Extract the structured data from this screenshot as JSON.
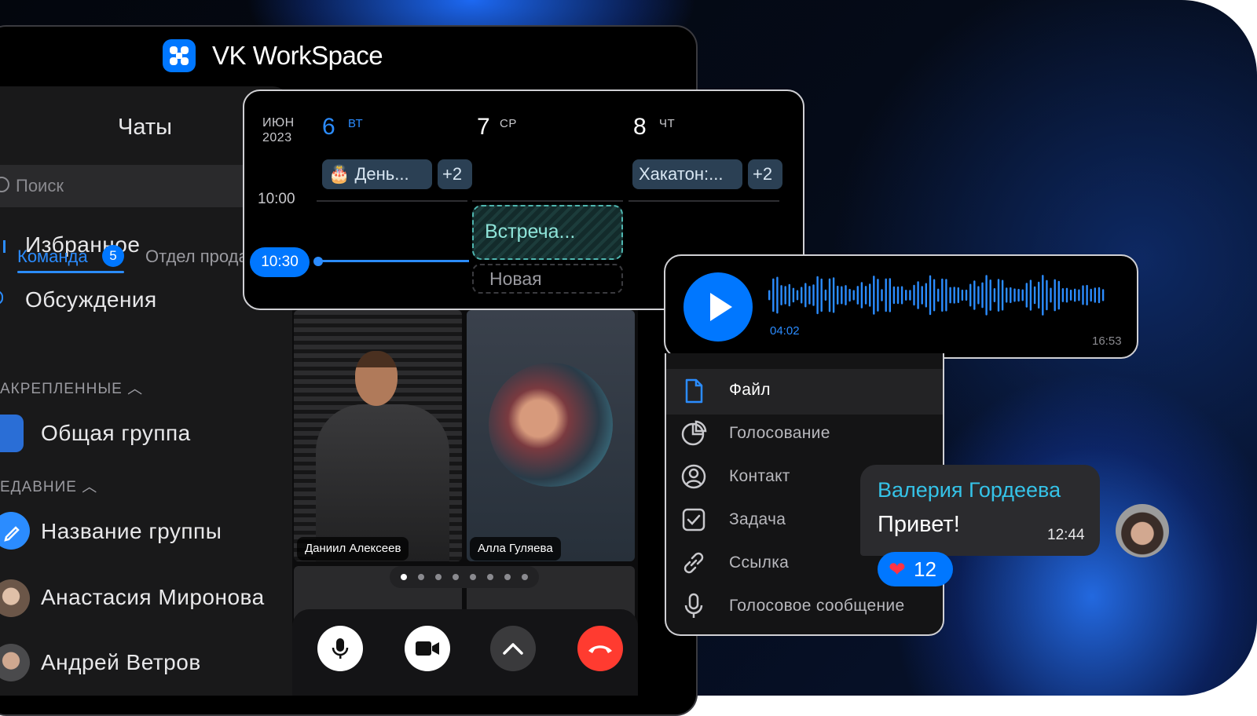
{
  "app": {
    "brand": "VK WorkSpace"
  },
  "sidebar": {
    "title": "Чаты",
    "search_placeholder": "Поиск",
    "favorites": "Избранное",
    "discussions": "Обсуждения",
    "tabs": [
      {
        "label": "Команда",
        "badge": "5"
      },
      {
        "label": "Отдел продаж"
      }
    ],
    "pinned_header": "АКРЕПЛЕННЫЕ",
    "pinned": [
      {
        "name": "Общая группа"
      }
    ],
    "recent_header": "ЕДАВНИЕ",
    "recent": [
      {
        "name": "Название группы"
      },
      {
        "name": "Анастасия Миронова"
      },
      {
        "name": "Андрей Ветров"
      }
    ]
  },
  "calendar": {
    "month": "ИЮН",
    "year": "2023",
    "days": [
      {
        "num": "6",
        "name": "ВТ",
        "color": "#2b8cff"
      },
      {
        "num": "7",
        "name": "СР",
        "color": "#ffffff"
      },
      {
        "num": "8",
        "name": "ЧТ",
        "color": "#ffffff"
      }
    ],
    "events": [
      {
        "title": "🎂 День...",
        "more": "+2"
      },
      {
        "title": "Хакатон:...",
        "more": "+2"
      }
    ],
    "time_10": "10:00",
    "now": "10:30",
    "meeting": "Встреча...",
    "new_slot": "Новая"
  },
  "video": {
    "participants": [
      {
        "name": "Даниил Алексеев"
      },
      {
        "name": "Алла Гуляева"
      }
    ],
    "page_dots": 8,
    "active_dot": 0
  },
  "audio": {
    "elapsed": "04:02",
    "sent_at": "16:53"
  },
  "attach_menu": {
    "items": [
      {
        "label": "Файл",
        "icon": "file-icon"
      },
      {
        "label": "Голосование",
        "icon": "poll-icon"
      },
      {
        "label": "Контакт",
        "icon": "contact-icon"
      },
      {
        "label": "Задача",
        "icon": "task-icon"
      },
      {
        "label": "Ссылка",
        "icon": "link-icon"
      },
      {
        "label": "Голосовое сообщение",
        "icon": "microphone-icon"
      }
    ]
  },
  "message": {
    "author": "Валерия Гордеева",
    "text": "Привет!",
    "time": "12:44",
    "reaction": {
      "emoji": "❤",
      "count": "12"
    }
  },
  "colors": {
    "accent": "#0077ff",
    "accent_text": "#2b8cff",
    "author": "#35c3e8",
    "hangup": "#ff3b30"
  }
}
